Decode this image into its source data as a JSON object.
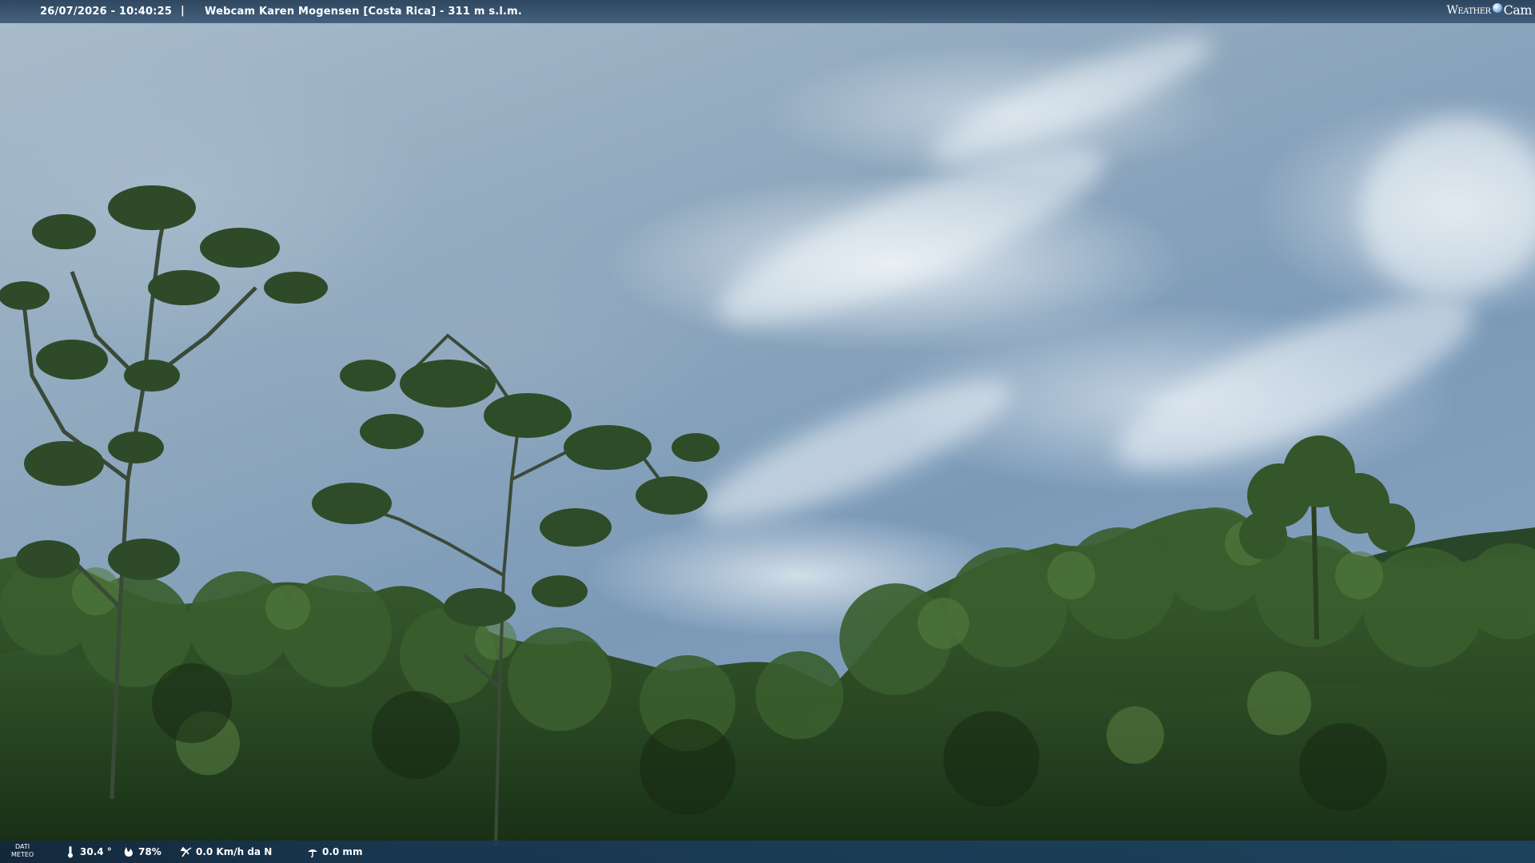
{
  "header": {
    "datetime": "26/07/2026 - 10:40:25",
    "separator": "|",
    "title": "Webcam Karen Mogensen [Costa Rica] - 311 m s.l.m."
  },
  "logo": {
    "part1": "Weather",
    "part2": "Cam",
    "globe_icon": "globe-icon"
  },
  "footer": {
    "label_line1": "DATI",
    "label_line2": "METEO",
    "temperature": "30.4 °",
    "humidity": "78%",
    "wind": "0.0 Km/h da N",
    "rain": "0.0 mm",
    "icons": {
      "temperature": "thermometer-icon",
      "humidity": "humidity-drop-icon",
      "wind": "wind-vane-icon",
      "rain": "rain-gauge-icon"
    }
  },
  "colors": {
    "bar_bg": "#263e58",
    "text": "#ffffff",
    "sky": "#8ea7bd",
    "forest_dark": "#1f3a1c",
    "forest_mid": "#2f5228",
    "forest_light": "#4a7038"
  }
}
